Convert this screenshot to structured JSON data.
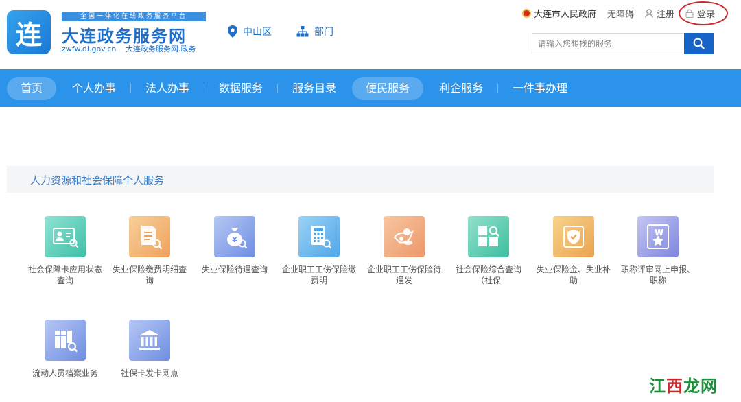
{
  "header": {
    "logo_char": "连",
    "tagline": "全国一体化在线政务服务平台",
    "site_title": "大连政务服务网",
    "domain": "zwfw.dl.gov.cn",
    "sub_name": "大连政务服务网.政务",
    "region": "中山区",
    "department": "部门",
    "gov_link": "大连市人民政府",
    "accessibility": "无障碍",
    "register": "注册",
    "login": "登录",
    "search_placeholder": "请输入您想找的服务"
  },
  "nav": {
    "items": [
      {
        "label": "首页",
        "active": true
      },
      {
        "label": "个人办事",
        "active": false
      },
      {
        "label": "法人办事",
        "active": false
      },
      {
        "label": "数据服务",
        "active": false
      },
      {
        "label": "服务目录",
        "active": false
      },
      {
        "label": "便民服务",
        "active": true
      },
      {
        "label": "利企服务",
        "active": false
      },
      {
        "label": "一件事办理",
        "active": false
      }
    ]
  },
  "section": {
    "title": "人力资源和社会保障个人服务",
    "tiles": [
      {
        "label": "社会保障卡应用状态查询",
        "icon": "id-card-search-icon",
        "color": "#4cc4ad"
      },
      {
        "label": "失业保险缴费明细查询",
        "icon": "document-search-icon",
        "color": "#eea25a"
      },
      {
        "label": "失业保险待遇查询",
        "icon": "money-bag-search-icon",
        "color": "#6f8ee2"
      },
      {
        "label": "企业职工工伤保险缴费明",
        "icon": "calculator-search-icon",
        "color": "#4fa6e8"
      },
      {
        "label": "企业职工工伤保险待遇发",
        "icon": "coins-icon",
        "color": "#ec976a"
      },
      {
        "label": "社会保险综合查询（社保",
        "icon": "grid-search-icon",
        "color": "#3cbf9f"
      },
      {
        "label": "失业保险金、失业补助",
        "icon": "shield-icon",
        "color": "#eba24e"
      },
      {
        "label": "职称评审网上申报、职称",
        "icon": "medal-icon",
        "color": "#7f86de"
      },
      {
        "label": "流动人员档案业务",
        "icon": "files-search-icon",
        "color": "#6f8ee2"
      },
      {
        "label": "社保卡发卡网点",
        "icon": "bank-icon",
        "color": "#6f8ee2"
      }
    ]
  },
  "watermark": {
    "part1": "江",
    "part2": "西",
    "part3": "龙网"
  }
}
